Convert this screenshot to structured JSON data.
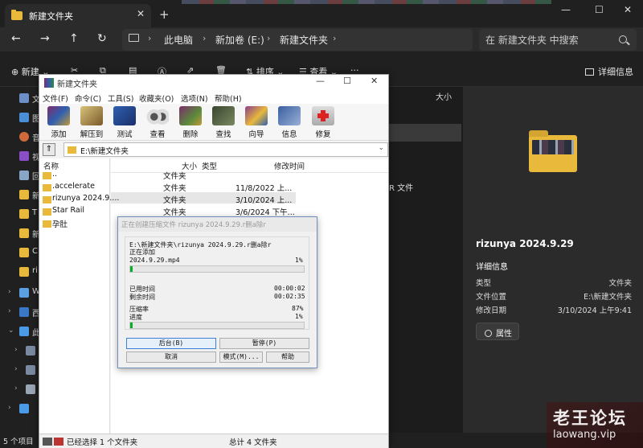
{
  "explorer": {
    "tab_title": "新建文件夹",
    "tab_close": "✕",
    "new_tab": "+",
    "window_buttons": [
      "—",
      "☐",
      "✕"
    ],
    "nav": {
      "back": "←",
      "forward": "→",
      "up": "↑",
      "refresh": "↻"
    },
    "breadcrumb": [
      "此电脑",
      "新加卷 (E:)",
      "新建文件夹"
    ],
    "chevron": "›",
    "search_placeholder": "在 新建文件夹 中搜索",
    "toolbar": {
      "new": "新建",
      "sort": "排序",
      "view": "查看",
      "more": "···",
      "details": "详细信息"
    },
    "sidebar_labels": [
      "文",
      "图",
      "音",
      "视",
      "回",
      "新",
      "T",
      "新",
      "C",
      "ri",
      "W",
      "西",
      "此"
    ],
    "list_column": "大小",
    "list_fragment": "R 文件",
    "details_pane": {
      "title": "rizunya 2024.9.29",
      "section": "详细信息",
      "props": [
        {
          "k": "类型",
          "v": "文件夹"
        },
        {
          "k": "文件位置",
          "v": "E:\\新建文件夹"
        },
        {
          "k": "修改日期",
          "v": "3/10/2024 上午9:41"
        }
      ],
      "properties_button": "属性"
    },
    "status_left": "5 个项目"
  },
  "winrar": {
    "title": "新建文件夹",
    "menu": [
      "文件(F)",
      "命令(C)",
      "工具(S)",
      "收藏夹(O)",
      "选项(N)",
      "帮助(H)"
    ],
    "tools": [
      {
        "label": "添加",
        "icon": "add-archive-icon",
        "color": "#8a3c7c"
      },
      {
        "label": "解压到",
        "icon": "extract-to-icon",
        "color": "#c49a3a"
      },
      {
        "label": "测试",
        "icon": "test-icon",
        "color": "#2f5fb0"
      },
      {
        "label": "查看",
        "icon": "view-icon",
        "color": "#9aa0a8"
      },
      {
        "label": "删除",
        "icon": "delete-icon",
        "color": "#5a8a3c"
      },
      {
        "label": "查找",
        "icon": "find-icon",
        "color": "#4f5a3a"
      },
      {
        "label": "向导",
        "icon": "wizard-icon",
        "color": "#8a3c8c"
      },
      {
        "label": "信息",
        "icon": "info-icon",
        "color": "#3a5fa0"
      },
      {
        "label": "修复",
        "icon": "repair-icon",
        "color": "#c8c8c8"
      }
    ],
    "path": "E:\\新建文件夹",
    "columns": {
      "name": "名称",
      "size": "大小",
      "type": "类型",
      "modified": "修改时间"
    },
    "files": [
      {
        "name": "..",
        "type": "文件夹",
        "modified": ""
      },
      {
        "name": ".accelerate",
        "type": "文件夹",
        "modified": "11/8/2022 上..."
      },
      {
        "name": "rizunya 2024.9....",
        "type": "文件夹",
        "modified": "3/10/2024 上..."
      },
      {
        "name": "Star Rail",
        "type": "文件夹",
        "modified": "3/6/2024 下午..."
      },
      {
        "name": "孕肚",
        "type": "",
        "modified": ""
      }
    ],
    "status_left": "已经选择 1 个文件夹",
    "status_right": "总计 4 文件夹"
  },
  "progress": {
    "title": "正在创建压缩文件 rizunya 2024.9.29.r删a除r",
    "archive_line": "E:\\新建文件夹\\rizunya 2024.9.29.r删a除r",
    "action": "正在添加",
    "file": "2024.9.29.mp4",
    "file_percent": "1%",
    "file_progress": 0.01,
    "elapsed_label": "已用时间",
    "elapsed": "00:00:02",
    "remaining_label": "剩余时间",
    "remaining": "00:02:35",
    "ratio_label": "压缩率",
    "ratio": "87%",
    "progress_label": "进度",
    "progress_percent": "1%",
    "total_progress": 0.01,
    "buttons": {
      "background": "后台(B)",
      "pause": "暂停(P)",
      "cancel": "取消",
      "mode": "模式(M)...",
      "help": "帮助"
    }
  },
  "watermark": {
    "title": "老王论坛",
    "url": "laowang.vip"
  }
}
